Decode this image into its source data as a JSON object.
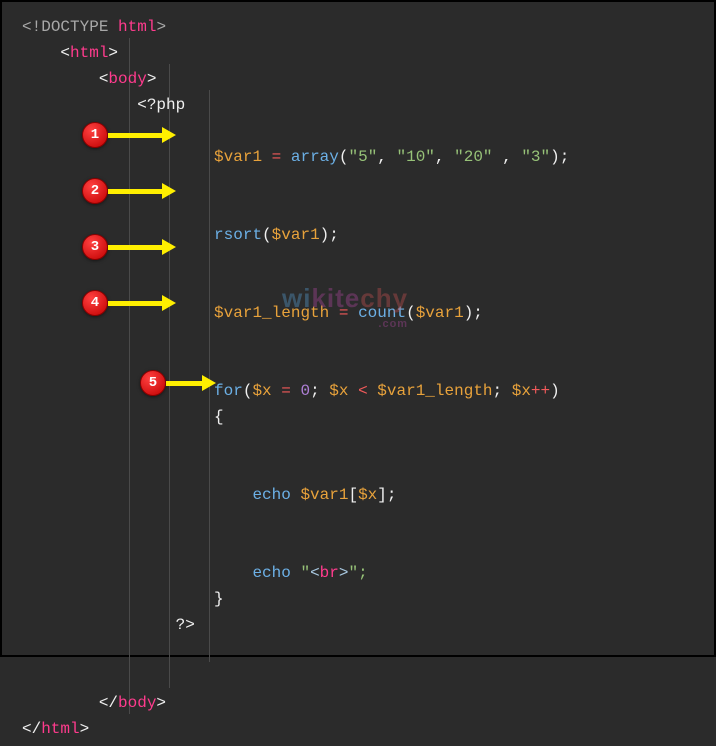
{
  "code": {
    "l1_lt": "<",
    "l1_doctype": "!DOCTYPE",
    "l1_sp": " ",
    "l1_html": "html",
    "l1_gt": ">",
    "l2_open": "<",
    "l2_tag": "html",
    "l2_close": ">",
    "l3_open": "<",
    "l3_tag": "body",
    "l3_close": ">",
    "l4_php": "<?php",
    "l5_var": "$var1",
    "l5_eq": " = ",
    "l5_fn": "array",
    "l5_p1": "(",
    "l5_s1": "\"5\"",
    "l5_c1": ", ",
    "l5_s2": "\"10\"",
    "l5_c2": ", ",
    "l5_s3": "\"20\"",
    "l5_c3": " , ",
    "l5_s4": "\"3\"",
    "l5_p2": ");",
    "l6_fn": "rsort",
    "l6_p1": "(",
    "l6_var": "$var1",
    "l6_p2": ");",
    "l7_var": "$var1_length",
    "l7_eq": " = ",
    "l7_fn": "count",
    "l7_p1": "(",
    "l7_arg": "$var1",
    "l7_p2": ");",
    "l8_for": "for",
    "l8_p1": "(",
    "l8_x": "$x",
    "l8_eq": " = ",
    "l8_zero": "0",
    "l8_sc1": "; ",
    "l8_x2": "$x",
    "l8_lt": " < ",
    "l8_len": "$var1_length",
    "l8_sc2": "; ",
    "l8_x3": "$x",
    "l8_pp": "++",
    "l8_p2": ")",
    "l9_brace": "{",
    "l10_echo": "echo",
    "l10_sp": " ",
    "l10_var": "$var1",
    "l10_b1": "[",
    "l10_x": "$x",
    "l10_b2": "];",
    "l11_echo": "echo",
    "l11_sp": " ",
    "l11_q1": "\"",
    "l11_lt": "<",
    "l11_br": "br",
    "l11_gt": ">",
    "l11_q2": "\";",
    "l12_brace": "}",
    "l13_php": "?>",
    "l14_open": "</",
    "l14_tag": "body",
    "l14_close": ">",
    "l15_open": "</",
    "l15_tag": "html",
    "l15_close": ">"
  },
  "callouts": {
    "c1": "1",
    "c2": "2",
    "c3": "3",
    "c4": "4",
    "c5": "5"
  },
  "watermark": {
    "t1": "wi",
    "t2": "kite",
    "t3": "chy",
    "sub": ".com"
  }
}
